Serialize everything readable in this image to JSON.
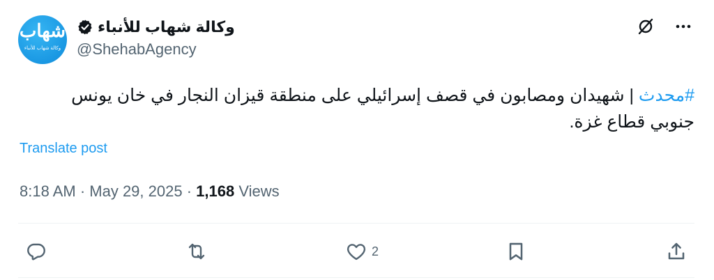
{
  "author": {
    "display_name": "وكالة شهاب للأنباء",
    "handle": "@ShehabAgency",
    "avatar_logo_text": "شهاب",
    "avatar_logo_sub": "وكالة شهاب للأنباء",
    "verified_icon": "verified-badge-icon"
  },
  "tweet": {
    "hashtag": "#محدث",
    "body": " | شهيدان ومصابون في قصف إسرائيلي على منطقة قيزان النجار في خان يونس جنوبي قطاع غزة."
  },
  "translate_label": "Translate post",
  "meta": {
    "timestamp": "8:18 AM · May 29, 2025",
    "separator": " · ",
    "views_count": "1,168",
    "views_label": " Views"
  },
  "actions": {
    "reply": {
      "icon": "reply-icon",
      "count": ""
    },
    "repost": {
      "icon": "repost-icon",
      "count": ""
    },
    "like": {
      "icon": "heart-icon",
      "count": "2"
    },
    "bookmark": {
      "icon": "bookmark-icon",
      "count": ""
    },
    "share": {
      "icon": "share-icon",
      "count": ""
    }
  },
  "top_icons": [
    "grok-slash-icon",
    "more-icon"
  ],
  "colors": {
    "accent": "#1d9bf0",
    "text": "#0f1419",
    "secondary": "#536471",
    "divider": "#eff3f4"
  }
}
